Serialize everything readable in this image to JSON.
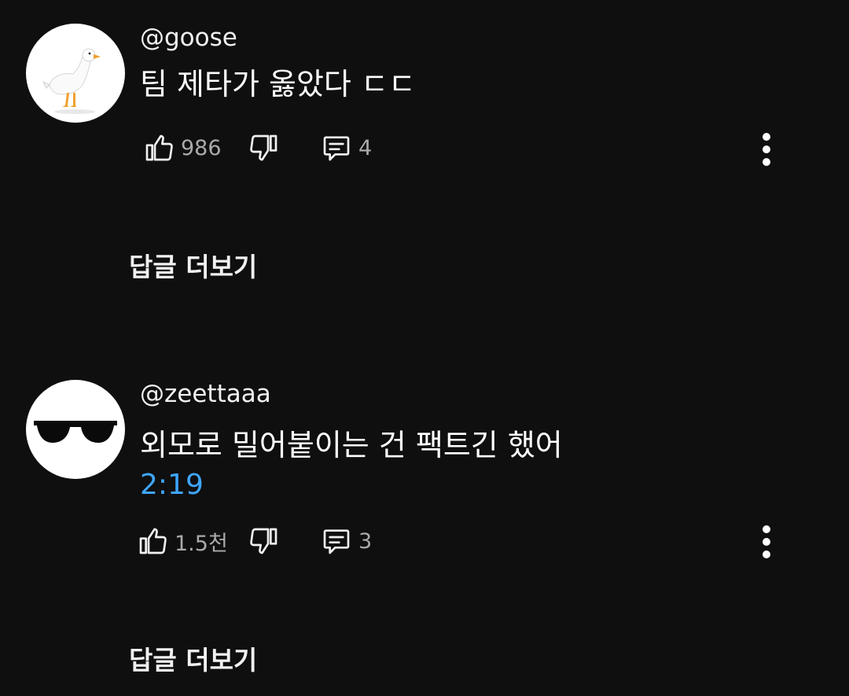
{
  "comments": [
    {
      "avatar_icon": "duck-icon",
      "handle": "@goose",
      "text": "팀 제타가 옳았다 ㄷㄷ",
      "timestamp": "",
      "likes": "986",
      "reply_count": "4",
      "replies_label": "답글 더보기"
    },
    {
      "avatar_icon": "sunglasses-icon",
      "handle": "@zeettaaa",
      "text": "외모로 밀어붙이는 건 팩트긴 했어",
      "timestamp": "2:19",
      "likes": "1.5천",
      "reply_count": "3",
      "replies_label": "답글 더보기"
    }
  ],
  "colors": {
    "background": "#0f0f0f",
    "text": "#f1f1f1",
    "muted": "#aaaaaa",
    "link": "#3ea6ff"
  }
}
